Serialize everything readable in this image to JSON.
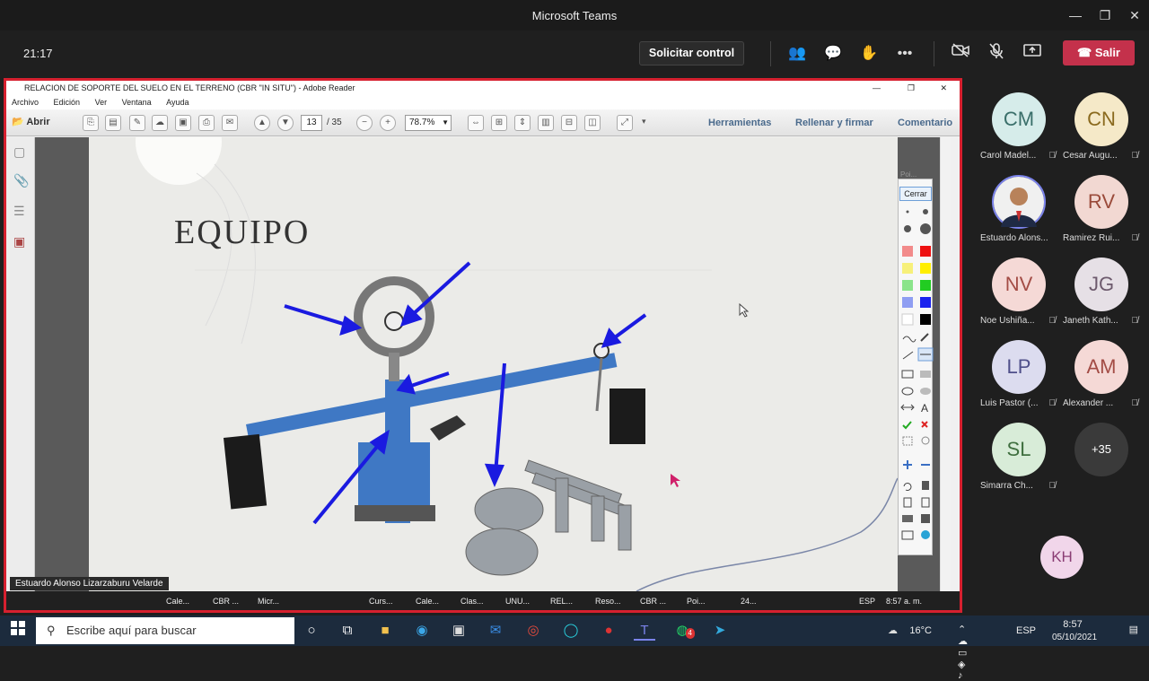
{
  "window": {
    "title": "Microsoft Teams"
  },
  "meeting": {
    "time": "21:17",
    "request_control": "Solicitar control",
    "leave": "Salir"
  },
  "reader": {
    "title": "RELACION DE SOPORTE DEL SUELO EN EL TERRENO (CBR \"IN SITU\") - Adobe Reader",
    "menu": [
      "Archivo",
      "Edición",
      "Ver",
      "Ventana",
      "Ayuda"
    ],
    "open": "Abrir",
    "page_current": "13",
    "page_total": "/ 35",
    "zoom": "78.7%",
    "tabs": [
      "Herramientas",
      "Rellenar y firmar",
      "Comentario"
    ],
    "slide_title": "EQUIPO",
    "palette_close": "Cerrar",
    "palette_header": "Poi..."
  },
  "presenter": "Estuardo Alonso Lizarzaburu Velarde",
  "shared_taskbar": [
    "Cale...",
    "CBR ...",
    "Micr...",
    "Curs...",
    "Cale...",
    "Clas...",
    "UNU...",
    "REL...",
    "Reso...",
    "CBR ...",
    "Poi...",
    "24...",
    "ESP",
    "8:57 a. m."
  ],
  "participants": [
    {
      "initials": "CM",
      "name": "Carol Madel...",
      "bg": "#d6ecea",
      "fg": "#3a6f6a"
    },
    {
      "initials": "CN",
      "name": "Cesar Augu...",
      "bg": "#f5e9c8",
      "fg": "#8a6a1e"
    },
    {
      "initials": "",
      "name": "Estuardo Alons...",
      "bg": "#3b4a6b",
      "fg": "#fff"
    },
    {
      "initials": "RV",
      "name": "Ramirez Rui...",
      "bg": "#f2d8d2",
      "fg": "#9a4a3a"
    },
    {
      "initials": "NV",
      "name": "Noe Ushiña...",
      "bg": "#f5d9d6",
      "fg": "#a34c45"
    },
    {
      "initials": "JG",
      "name": "Janeth Kath...",
      "bg": "#e6e0e6",
      "fg": "#6d5a6d"
    },
    {
      "initials": "LP",
      "name": "Luis Pastor (...",
      "bg": "#dcdcef",
      "fg": "#4f4f8a"
    },
    {
      "initials": "AM",
      "name": "Alexander ...",
      "bg": "#f5d9d6",
      "fg": "#a34c45"
    },
    {
      "initials": "SL",
      "name": "Simarra Ch...",
      "bg": "#d8ecd8",
      "fg": "#3f6f3f"
    },
    {
      "initials": "+35",
      "name": "",
      "bg": "#3a3a3a",
      "fg": "#fff"
    }
  ],
  "extra_participant": {
    "initials": "KH",
    "bg": "#f1d6ea",
    "fg": "#8a3d74"
  },
  "taskbar": {
    "search_placeholder": "Escribe aquí para buscar",
    "temp": "16°C",
    "lang": "ESP",
    "time": "8:57",
    "date": "05/10/2021",
    "badge": "4"
  }
}
